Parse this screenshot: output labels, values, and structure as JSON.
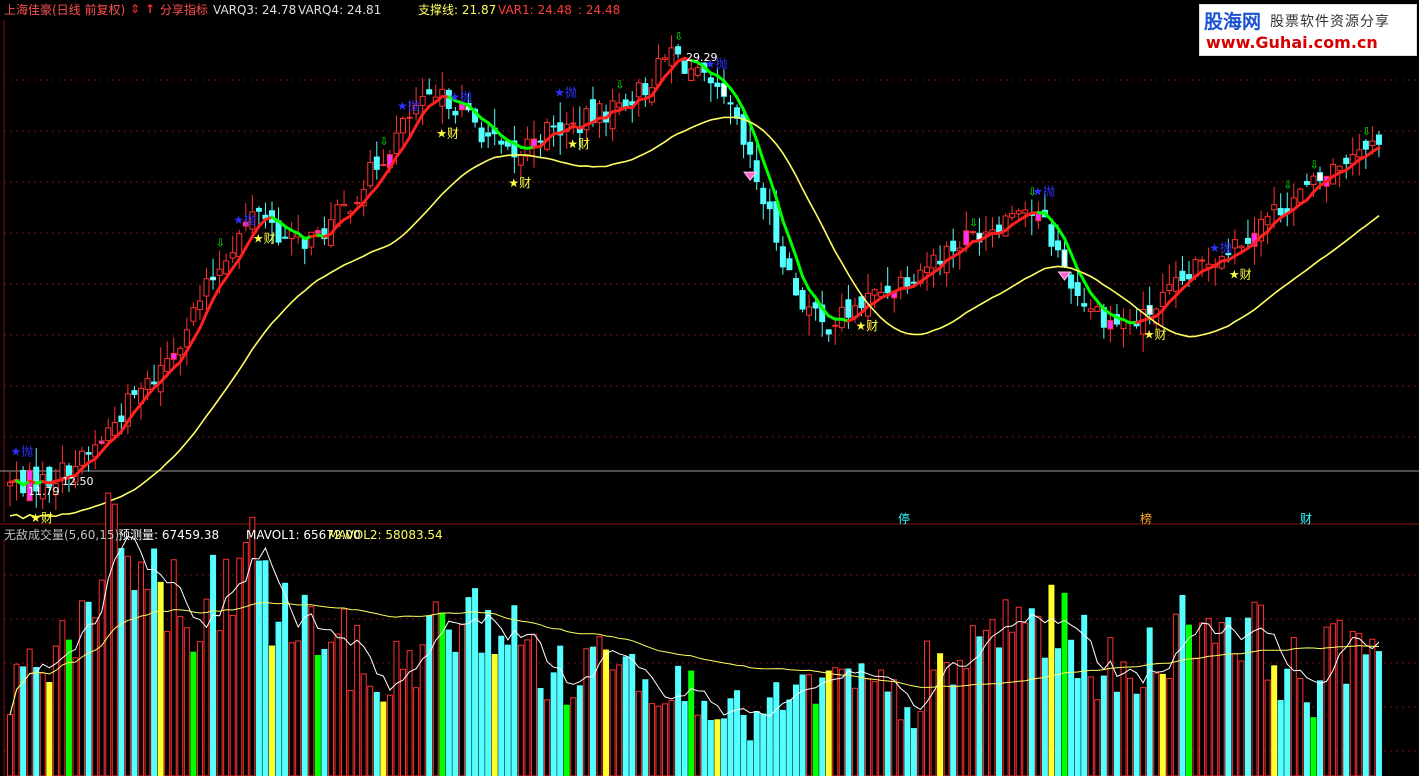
{
  "header": {
    "stock_title": "上海佳豪(日线 前复权)",
    "indicator_name": "分享指标",
    "varq3": "VARQ3: 24.78",
    "varq4": "VARQ4: 24.81",
    "support": "支撑线: 21.87",
    "var1": "VAR1: 24.48",
    "var_extra": ": 24.48"
  },
  "logo": {
    "brand": "股海网",
    "tagline": "股票软件资源分享",
    "url": "www.Guhai.com.cn"
  },
  "volume_header": {
    "title": "无敌成交量(5,60,15)",
    "forecast": "预测量: 67459.38",
    "mavol1": "MAVOL1: 65672.00",
    "mavol2": "MAVOL2: 58083.54"
  },
  "colors": {
    "up": "#ff3030",
    "down": "#54ffff",
    "ma_red": "#ff2020",
    "ma_green": "#00ff00",
    "support_line": "#ffff60",
    "grid": "#7a1010",
    "buy_marker": "#ffff40",
    "sell_marker": "#3030ff",
    "header_red": "#ff3c3c",
    "header_yellow": "#ffff60"
  },
  "annotations": {
    "buy_label": "★财",
    "sell_label": "★抛",
    "peak_label": "29.29",
    "low_label": "11.79",
    "low_price_note": "12.50",
    "bottom_tags": [
      "停",
      "榜",
      "财"
    ]
  },
  "chart_data": [
    {
      "type": "candlestick",
      "title": "上海佳豪(日线 前复权)",
      "ylim": [
        11.5,
        30
      ],
      "labeled_points": {
        "high": 29.29,
        "low": 11.79
      },
      "support": 21.87,
      "series": [
        {
          "name": "VARQ3",
          "last": 24.78
        },
        {
          "name": "VARQ4",
          "last": 24.81
        },
        {
          "name": "VAR1",
          "last": 24.48
        }
      ],
      "close_anchors": [
        [
          0,
          12.1
        ],
        [
          6,
          12.3
        ],
        [
          12,
          13.2
        ],
        [
          18,
          15.2
        ],
        [
          22,
          16.2
        ],
        [
          26,
          17.8
        ],
        [
          33,
          21.0
        ],
        [
          38,
          22.8
        ],
        [
          42,
          21.5
        ],
        [
          47,
          21.6
        ],
        [
          52,
          23.0
        ],
        [
          57,
          24.8
        ],
        [
          62,
          26.6
        ],
        [
          67,
          27.0
        ],
        [
          73,
          25.5
        ],
        [
          77,
          24.5
        ],
        [
          80,
          25.6
        ],
        [
          86,
          25.9
        ],
        [
          92,
          26.6
        ],
        [
          97,
          27.4
        ],
        [
          101,
          28.8
        ],
        [
          105,
          27.8
        ],
        [
          110,
          26.5
        ],
        [
          114,
          23.8
        ],
        [
          120,
          19.5
        ],
        [
          124,
          18.2
        ],
        [
          128,
          18.7
        ],
        [
          132,
          19.4
        ],
        [
          138,
          20.3
        ],
        [
          146,
          21.6
        ],
        [
          152,
          22.4
        ],
        [
          154,
          23.0
        ],
        [
          158,
          22.1
        ],
        [
          163,
          19.4
        ],
        [
          168,
          18.4
        ],
        [
          172,
          18.3
        ],
        [
          176,
          19.2
        ],
        [
          182,
          20.6
        ],
        [
          188,
          21.6
        ],
        [
          194,
          22.8
        ],
        [
          200,
          23.8
        ],
        [
          207,
          25.4
        ],
        [
          209,
          25.1
        ]
      ],
      "buy_signals": [
        4,
        38,
        66,
        77,
        86,
        130,
        174,
        187
      ],
      "sell_signals": [
        1,
        35,
        60,
        68,
        84,
        107,
        157,
        184
      ],
      "green_arrows": [
        32,
        57,
        93,
        102,
        147,
        156,
        195,
        199,
        207
      ]
    },
    {
      "type": "bar",
      "title": "无敌成交量(5,60,15)",
      "ylim": [
        0,
        100000
      ],
      "mavol1_last": 65672.0,
      "mavol2_last": 58083.54,
      "forecast": 67459.38
    }
  ]
}
